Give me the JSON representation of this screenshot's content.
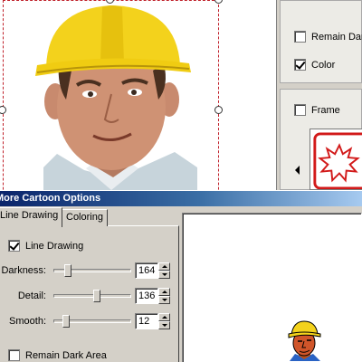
{
  "side_panel": {
    "remain_dark_label": "Remain Dark",
    "remain_dark_checked": false,
    "color_label": "Color",
    "color_checked": true,
    "frame_label": "Frame",
    "frame_checked": false
  },
  "dialog": {
    "title": "More Cartoon Options",
    "tabs": [
      {
        "label": "Line Drawing",
        "active": true
      },
      {
        "label": "Coloring",
        "active": false
      }
    ],
    "line_drawing_label": "Line Drawing",
    "line_drawing_checked": true,
    "controls": [
      {
        "label": "Darkness:",
        "value": "164"
      },
      {
        "label": "Detail:",
        "value": "136"
      },
      {
        "label": "Smooth:",
        "value": "12"
      }
    ],
    "remain_dark_area_label": "Remain Dark Area",
    "remain_dark_area_checked": false
  },
  "colors": {
    "helmet": "#f3d21c",
    "selection": "#c0202a",
    "title_bar": "#0a246a"
  }
}
